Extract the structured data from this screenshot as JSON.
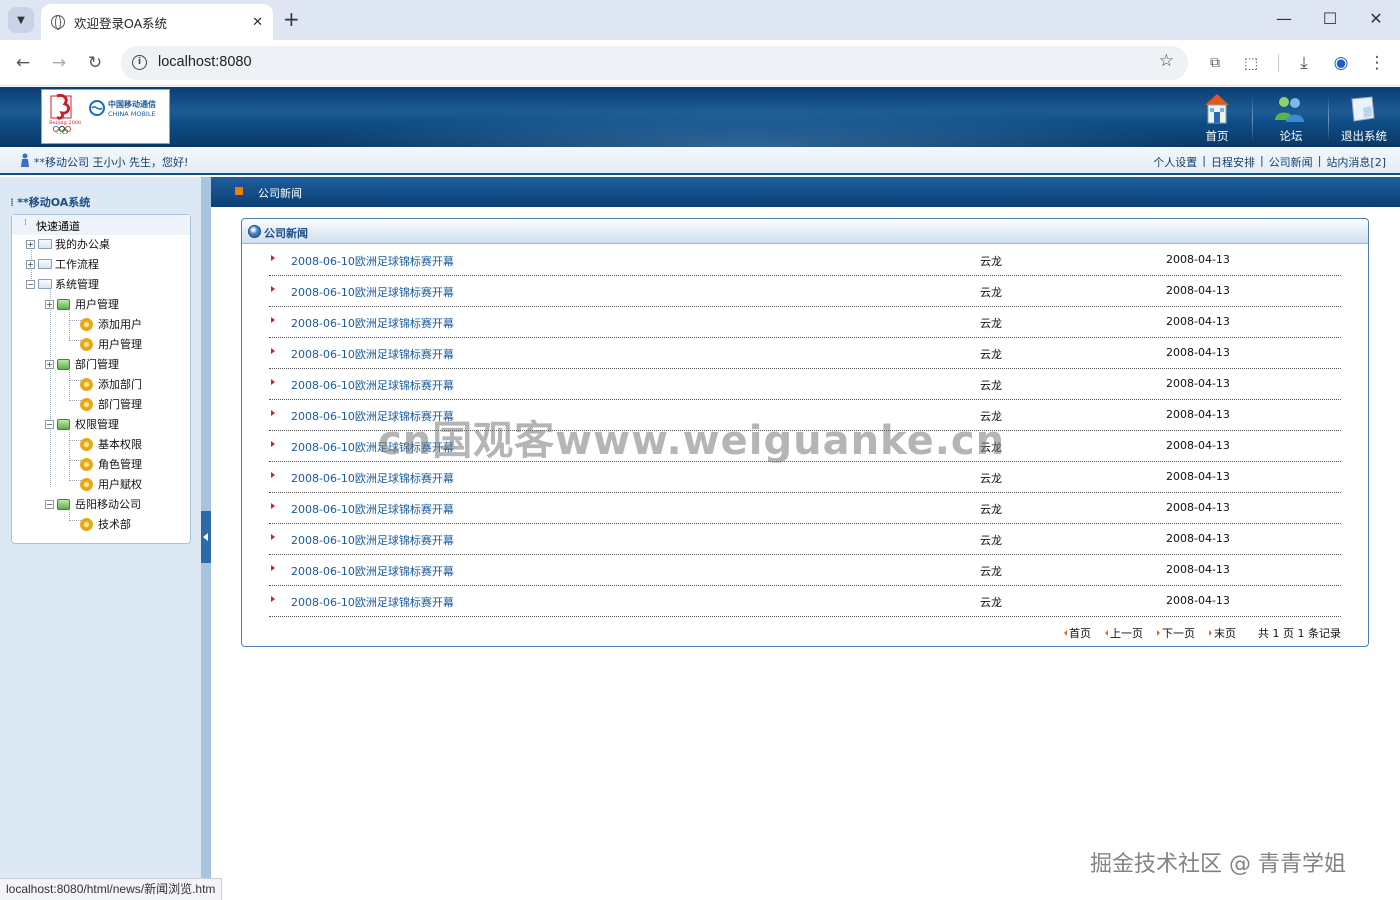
{
  "browser": {
    "tab_title": "欢迎登录OA系统",
    "url": "localhost:8080",
    "status_url": "localhost:8080/html/news/新闻浏览.htm"
  },
  "header": {
    "nav": [
      {
        "label": "首页",
        "icon": "home-icon"
      },
      {
        "label": "论坛",
        "icon": "forum-users-icon"
      },
      {
        "label": "退出系统",
        "icon": "exit-icon"
      }
    ]
  },
  "userbar": {
    "greeting": "**移动公司 王小小 先生，您好!",
    "links": [
      "个人设置",
      "日程安排",
      "公司新闻",
      "站内消息[2]"
    ]
  },
  "sidebar": {
    "system_title": "**移动OA系统",
    "quick_title": "快速通道",
    "tree": {
      "office": "我的办公桌",
      "workflow": "工作流程",
      "sysmgmt": "系统管理",
      "user_mgmt": "用户管理",
      "add_user": "添加用户",
      "user_manage": "用户管理",
      "dept_mgmt": "部门管理",
      "add_dept": "添加部门",
      "dept_manage": "部门管理",
      "perm_mgmt": "权限管理",
      "basic_perm": "基本权限",
      "role_mgmt": "角色管理",
      "user_grant": "用户赋权",
      "yueyang": "岳阳移动公司",
      "tech_dept": "技术部"
    }
  },
  "main": {
    "section_title": "公司新闻",
    "box_title": "公司新闻",
    "news": [
      {
        "title": "2008-06-10欧洲足球锦标赛开幕",
        "author": "云龙",
        "date": "2008-04-13"
      },
      {
        "title": "2008-06-10欧洲足球锦标赛开幕",
        "author": "云龙",
        "date": "2008-04-13"
      },
      {
        "title": "2008-06-10欧洲足球锦标赛开幕",
        "author": "云龙",
        "date": "2008-04-13"
      },
      {
        "title": "2008-06-10欧洲足球锦标赛开幕",
        "author": "云龙",
        "date": "2008-04-13"
      },
      {
        "title": "2008-06-10欧洲足球锦标赛开幕",
        "author": "云龙",
        "date": "2008-04-13"
      },
      {
        "title": "2008-06-10欧洲足球锦标赛开幕",
        "author": "云龙",
        "date": "2008-04-13"
      },
      {
        "title": "2008-06-10欧洲足球锦标赛开幕",
        "author": "云龙",
        "date": "2008-04-13"
      },
      {
        "title": "2008-06-10欧洲足球锦标赛开幕",
        "author": "云龙",
        "date": "2008-04-13"
      },
      {
        "title": "2008-06-10欧洲足球锦标赛开幕",
        "author": "云龙",
        "date": "2008-04-13"
      },
      {
        "title": "2008-06-10欧洲足球锦标赛开幕",
        "author": "云龙",
        "date": "2008-04-13"
      },
      {
        "title": "2008-06-10欧洲足球锦标赛开幕",
        "author": "云龙",
        "date": "2008-04-13"
      },
      {
        "title": "2008-06-10欧洲足球锦标赛开幕",
        "author": "云龙",
        "date": "2008-04-13"
      }
    ],
    "pager": {
      "first": "首页",
      "prev": "上一页",
      "next": "下一页",
      "last": "末页",
      "summary": "共 1 页 1 条记录"
    }
  },
  "overlay": {
    "watermark": "cn国观客www.weiguanke.cn",
    "watermark2": "掘金技术社区 @ 青青学姐"
  }
}
